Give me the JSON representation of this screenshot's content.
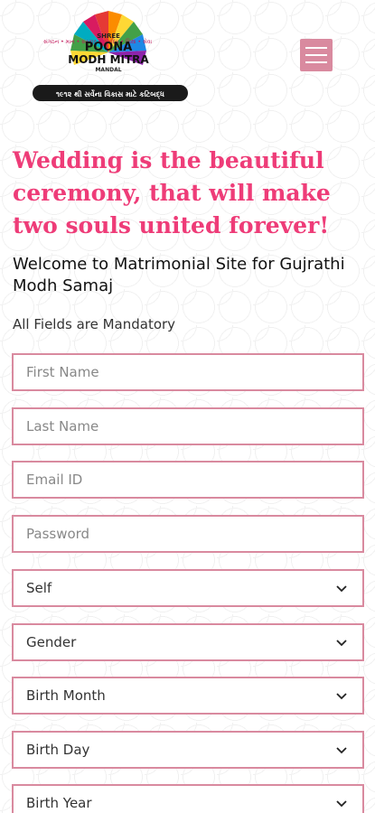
{
  "header": {
    "logo": {
      "name_line1": "SHREE",
      "name_line2": "POONA",
      "name_line3": "MODH MITRA",
      "name_line4": "MANDAL",
      "arc_text": "સંગઠન • માન • સંસ્કાર • સમૃદ્ધિ • શિક્ષા • સેવા",
      "ribbon_text": "૧૯૧૨ થી સર્વેના વિકાસ માટે કટિબદ્ધ",
      "colors": [
        "#e53935",
        "#fb8c00",
        "#fdd835",
        "#43a047",
        "#1e88e5",
        "#8e24aa",
        "#d81b60",
        "#00acc1"
      ]
    },
    "menu_icon": "hamburger-icon",
    "accent_color": "#d98a9f"
  },
  "hero": {
    "tagline": "Wedding is the beautiful ceremony, that will make two souls united forever!",
    "tagline_color": "#ee3c78",
    "welcome": "Welcome to Matrimonial Site for Gujrathi Modh Samaj",
    "mandatory_note": "All Fields are Mandatory"
  },
  "form": {
    "first_name": {
      "placeholder": "First Name",
      "value": ""
    },
    "last_name": {
      "placeholder": "Last Name",
      "value": ""
    },
    "email": {
      "placeholder": "Email ID",
      "value": ""
    },
    "password": {
      "placeholder": "Password",
      "value": ""
    },
    "profile_for": {
      "selected": "Self"
    },
    "gender": {
      "selected": "Gender"
    },
    "birth_month": {
      "selected": "Birth Month"
    },
    "birth_day": {
      "selected": "Birth Day"
    },
    "birth_year": {
      "selected": "Birth Year"
    }
  }
}
